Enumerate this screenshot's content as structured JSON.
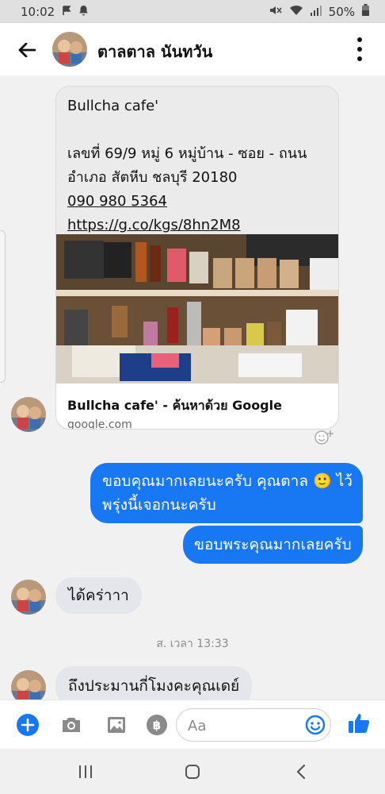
{
  "status_bar": {
    "time": "10:02",
    "battery": "50%"
  },
  "header": {
    "title": "ตาลตาล นันทวัน"
  },
  "shared_card": {
    "lines": [
      "Bullcha cafe'",
      "",
      "เลขที่ 69/9 หมู่ 6 หมู่บ้าน - ซอย - ถนน",
      "อำเภอ สัตหีบ ชลบุรี 20180"
    ],
    "phone": "090 980 5364",
    "link": "https://g.co/kgs/8hn2M8",
    "link_title": "Bullcha cafe' - ค้นหาด้วย Google",
    "link_domain": "google.com"
  },
  "messages": {
    "out_1_line1": "ขอบคุณมากเลยนะครับ คุณตาล 🙂 ไว้",
    "out_1_line2": "พรุ่งนี้เจอกนะครับ",
    "out_2": "ขอบพระคุณมากเลยครับ",
    "in_1": "ได้คร่าาา",
    "timestamp": "ส. เวลา 13:33",
    "in_2": "ถึงประมานกี่โมงคะคุณเดย์"
  },
  "composer": {
    "placeholder": "Aa"
  },
  "colors": {
    "accent": "#1877f2",
    "bubble_in": "#e4e6eb",
    "chat_bg": "#f1f1f1"
  }
}
